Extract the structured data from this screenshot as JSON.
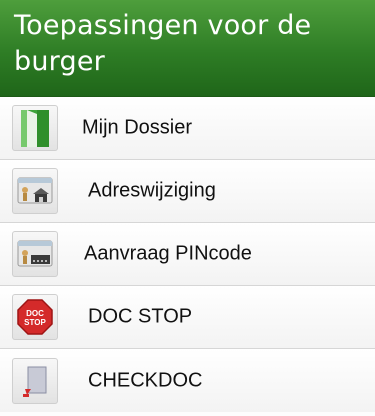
{
  "header": {
    "title": "Toepassingen voor de burger"
  },
  "items": [
    {
      "label": "Mijn Dossier",
      "icon": "green-door-icon"
    },
    {
      "label": "Adreswijziging",
      "icon": "id-card-house-icon"
    },
    {
      "label": "Aanvraag PINcode",
      "icon": "id-card-pin-icon"
    },
    {
      "label": "DOC STOP",
      "icon": "stop-sign-icon",
      "icon_text": [
        "DOC",
        "STOP"
      ]
    },
    {
      "label": "CHECKDOC",
      "icon": "document-check-icon"
    }
  ],
  "colors": {
    "header_top": "#4e9e3c",
    "header_bottom": "#1f6619",
    "header_text": "#ffffff",
    "stop_red": "#d42a2a"
  }
}
